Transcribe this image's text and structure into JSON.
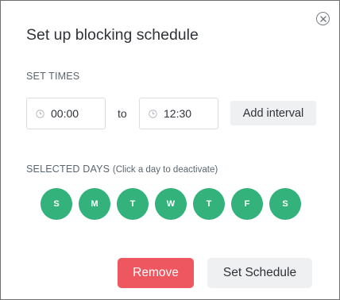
{
  "dialog": {
    "title": "Set up blocking schedule",
    "close_icon": "close-circle-icon"
  },
  "times": {
    "section_label": "SET TIMES",
    "start": {
      "value": "00:00",
      "icon": "clock-icon"
    },
    "separator": "to",
    "end": {
      "value": "12:30",
      "icon": "clock-icon"
    },
    "add_interval_label": "Add interval"
  },
  "days": {
    "section_label": "SELECTED DAYS",
    "hint": "(Click a day to deactivate)",
    "items": [
      {
        "label": "S",
        "active": true
      },
      {
        "label": "M",
        "active": true
      },
      {
        "label": "T",
        "active": true
      },
      {
        "label": "W",
        "active": true
      },
      {
        "label": "T",
        "active": true
      },
      {
        "label": "F",
        "active": true
      },
      {
        "label": "S",
        "active": true
      }
    ],
    "active_color": "#34b27b"
  },
  "actions": {
    "remove_label": "Remove",
    "remove_color": "#ee5760",
    "set_label": "Set Schedule"
  }
}
